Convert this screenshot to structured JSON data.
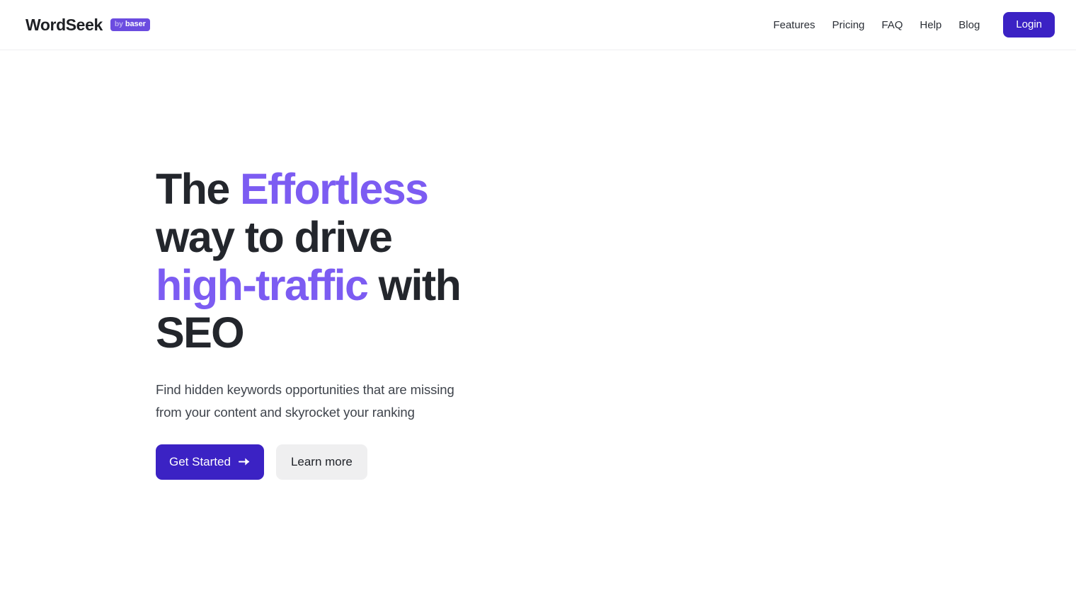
{
  "header": {
    "brand": {
      "name": "WordSeek",
      "badge_by": "by",
      "badge_name": "baser"
    },
    "nav_links": [
      {
        "label": "Features"
      },
      {
        "label": "Pricing"
      },
      {
        "label": "FAQ"
      },
      {
        "label": "Help"
      },
      {
        "label": "Blog"
      }
    ],
    "login_label": "Login"
  },
  "hero": {
    "headline": {
      "part1": "The ",
      "accent1": "Effortless",
      "part2": " way to drive ",
      "accent2": "high-traffic",
      "part3": " with SEO"
    },
    "subtext": "Find hidden keywords opportunities that are missing from your content and skyrocket your ranking",
    "primary_cta": {
      "label": "Get Started",
      "icon": "arrow-right-icon"
    },
    "secondary_cta": {
      "label": "Learn more"
    }
  },
  "colors": {
    "brand_indigo": "#3b22c4",
    "accent_purple": "#7c5cf2",
    "badge_purple": "#6b4ce0",
    "text_dark": "#23262c",
    "text_muted": "#3f444c",
    "surface_gray": "#efeff0",
    "border": "#efeff2",
    "background": "#ffffff"
  }
}
